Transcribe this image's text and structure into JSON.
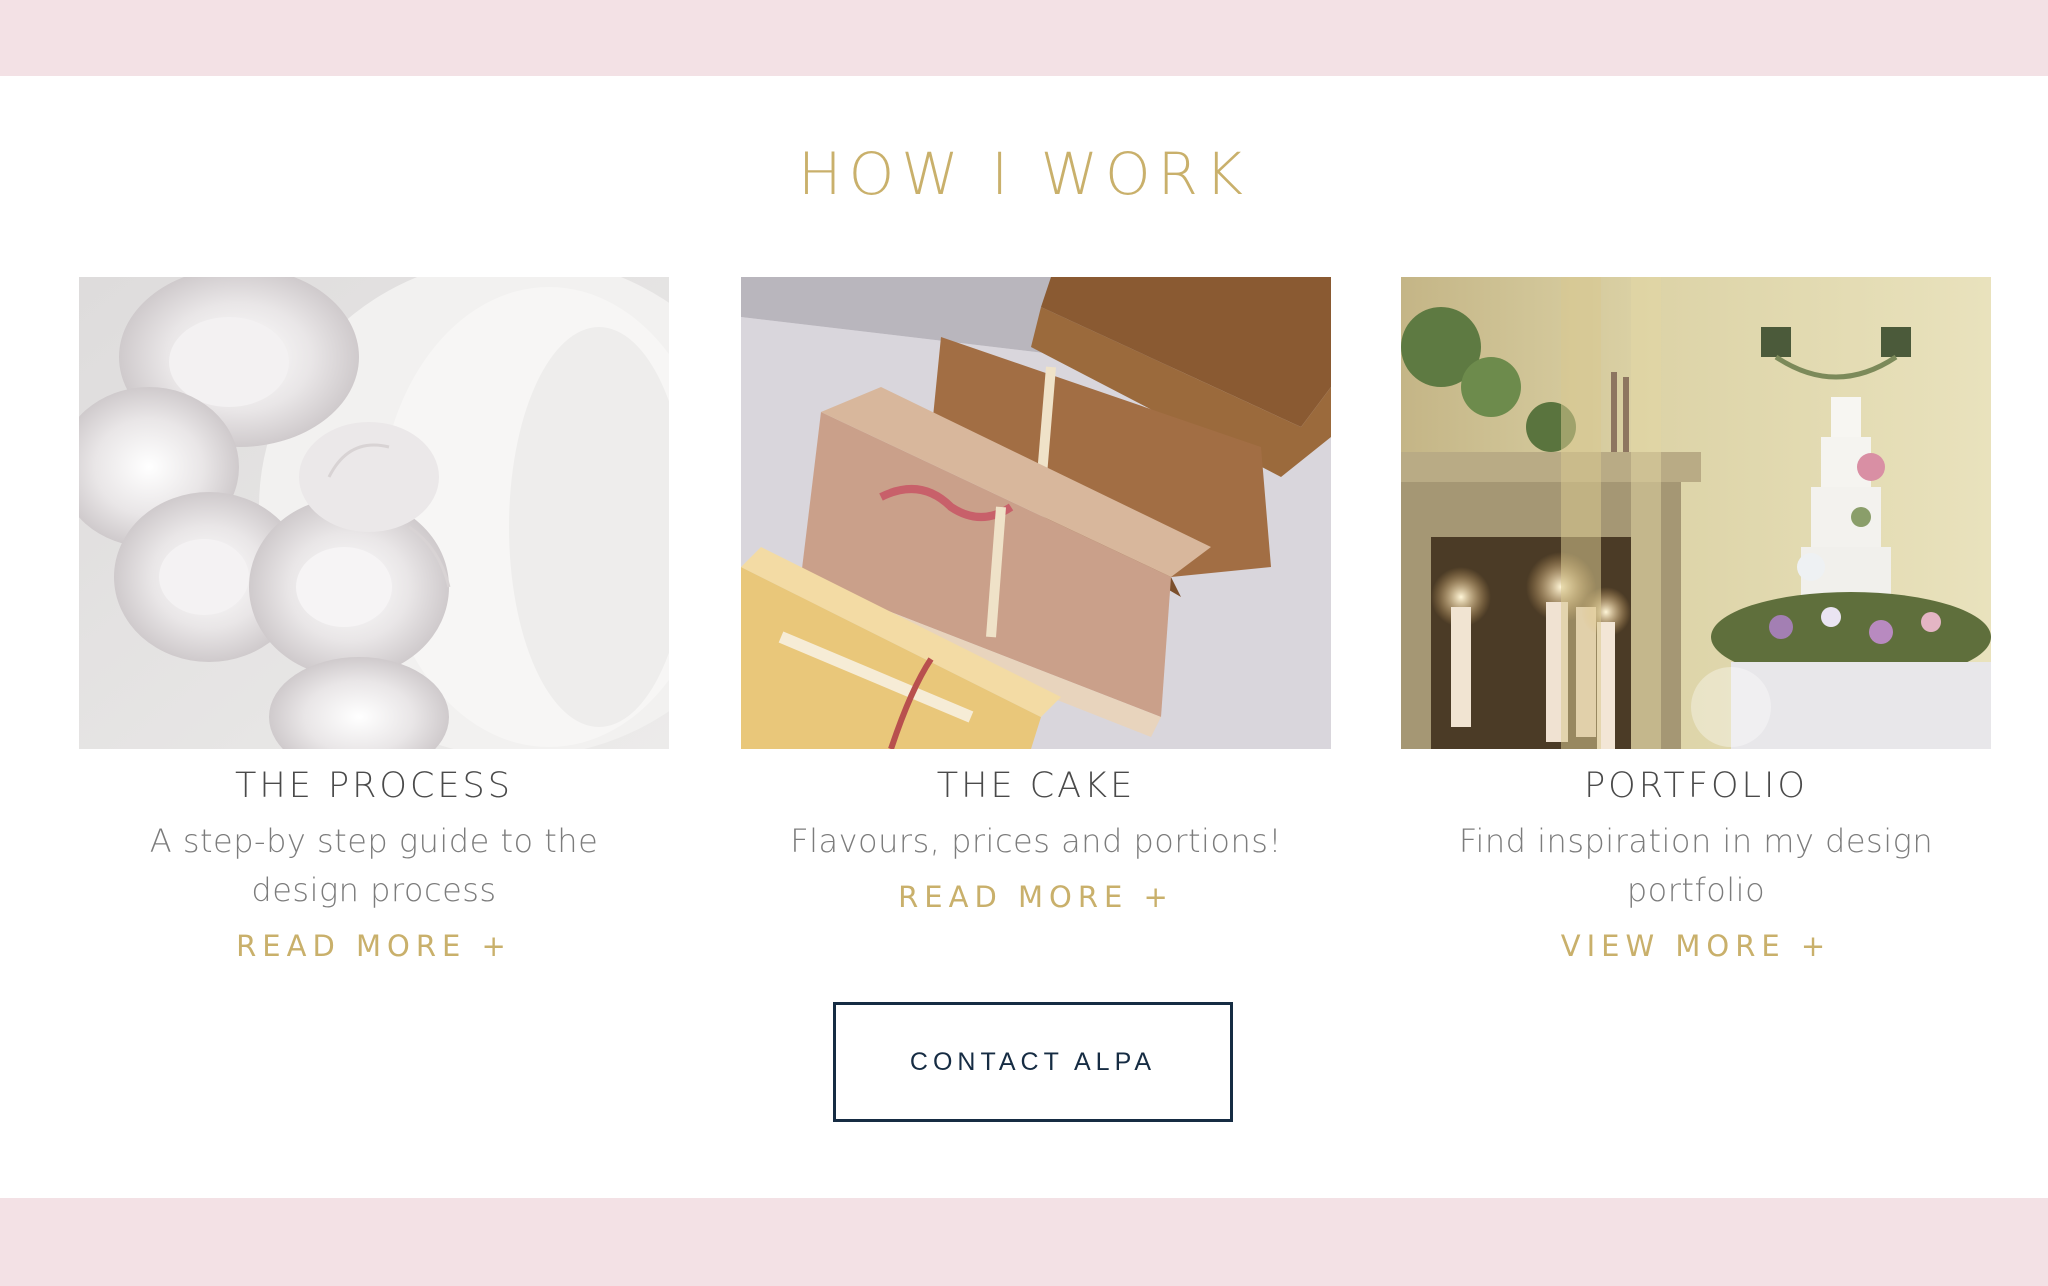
{
  "section": {
    "title": "HOW I WORK"
  },
  "cards": [
    {
      "title": "THE PROCESS",
      "description": "A step-by step guide to the design process",
      "link": "READ MORE +",
      "image_alt": "White sugar roses on a wedding cake"
    },
    {
      "title": "THE CAKE",
      "description": "Flavours, prices and portions!",
      "link": "READ MORE +",
      "image_alt": "Slices of layered sponge cake"
    },
    {
      "title": "PORTFOLIO",
      "description": "Find inspiration in my design portfolio",
      "link": "VIEW MORE +",
      "image_alt": "Tiered floral wedding cake by a fireplace with candles"
    }
  ],
  "contact": {
    "label": "CONTACT ALPA"
  },
  "colors": {
    "band": "#f3e1e5",
    "gold": "#c9b06b",
    "navy": "#162c43",
    "text_dark": "#4a4a4a",
    "text_muted": "#7c7c7c"
  }
}
